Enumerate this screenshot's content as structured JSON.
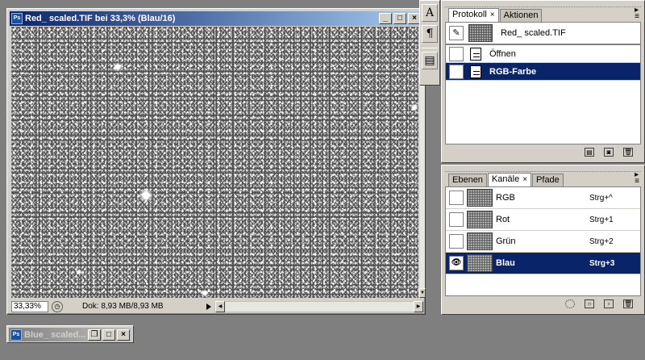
{
  "document": {
    "title": "Red_ scaled.TIF bei 33,3% (Blau/16)",
    "zoom": "33,33%",
    "doc_info": "Dok: 8,93 MB/8,93 MB"
  },
  "minimized_window": {
    "title": "Blue_ scaled..."
  },
  "toolstrip": {
    "items": [
      "A",
      "¶",
      "▤"
    ]
  },
  "history_panel": {
    "tabs": [
      {
        "label": "Protokoll",
        "active": true
      },
      {
        "label": "Aktionen",
        "active": false
      }
    ],
    "source": "Red_ scaled.TIF",
    "states": [
      {
        "label": "Öffnen",
        "selected": false
      },
      {
        "label": "RGB-Farbe",
        "selected": true
      }
    ]
  },
  "channels_panel": {
    "tabs": [
      {
        "label": "Ebenen",
        "active": false
      },
      {
        "label": "Kanäle",
        "active": true
      },
      {
        "label": "Pfade",
        "active": false
      }
    ],
    "channels": [
      {
        "name": "RGB",
        "shortcut": "Strg+^",
        "visible": false,
        "selected": false
      },
      {
        "name": "Rot",
        "shortcut": "Strg+1",
        "visible": false,
        "selected": false
      },
      {
        "name": "Grün",
        "shortcut": "Strg+2",
        "visible": false,
        "selected": false
      },
      {
        "name": "Blau",
        "shortcut": "Strg+3",
        "visible": true,
        "selected": true
      }
    ]
  },
  "colors": {
    "selection": "#0a246a",
    "titlebar_active": "#0a246a",
    "workspace": "#7f7f7f"
  }
}
